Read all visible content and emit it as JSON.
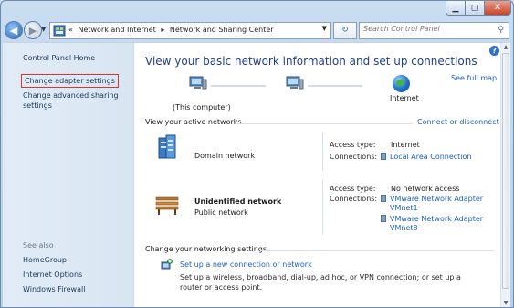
{
  "window": {
    "min_icon": "minimize-icon",
    "max_icon": "maximize-icon",
    "close_icon": "close-icon"
  },
  "nav": {
    "back_icon": "back-arrow-icon",
    "forward_icon": "forward-arrow-icon"
  },
  "address": {
    "overflow": "«",
    "crumbs": [
      "Network and Internet",
      "Network and Sharing Center"
    ],
    "separator": "▸"
  },
  "search": {
    "placeholder": "Search Control Panel"
  },
  "sidebar": {
    "items": [
      "Control Panel Home",
      "Change adapter settings",
      "Change advanced sharing settings"
    ],
    "see_also_title": "See also",
    "see_also": [
      "HomeGroup",
      "Internet Options",
      "Windows Firewall"
    ]
  },
  "main": {
    "heading": "View your basic network information and set up connections",
    "see_full_map": "See full map",
    "this_computer": "(This computer)",
    "internet": "Internet",
    "active_networks_title": "View your active networks",
    "connect_disconnect": "Connect or disconnect",
    "networks": [
      {
        "name": "Domain network",
        "access_type_label": "Access type:",
        "access_type": "Internet",
        "connections_label": "Connections:",
        "connections": [
          "Local Area Connection"
        ]
      },
      {
        "name": "Unidentified network",
        "type": "Public network",
        "access_type_label": "Access type:",
        "access_type": "No network access",
        "connections_label": "Connections:",
        "connections": [
          "VMware Network Adapter VMnet1",
          "VMware Network Adapter VMnet8"
        ]
      }
    ],
    "change_settings_title": "Change your networking settings",
    "setup_link": "Set up a new connection or network",
    "setup_desc": "Set up a wireless, broadband, dial-up, ad hoc, or VPN connection; or set up a router or access point."
  }
}
